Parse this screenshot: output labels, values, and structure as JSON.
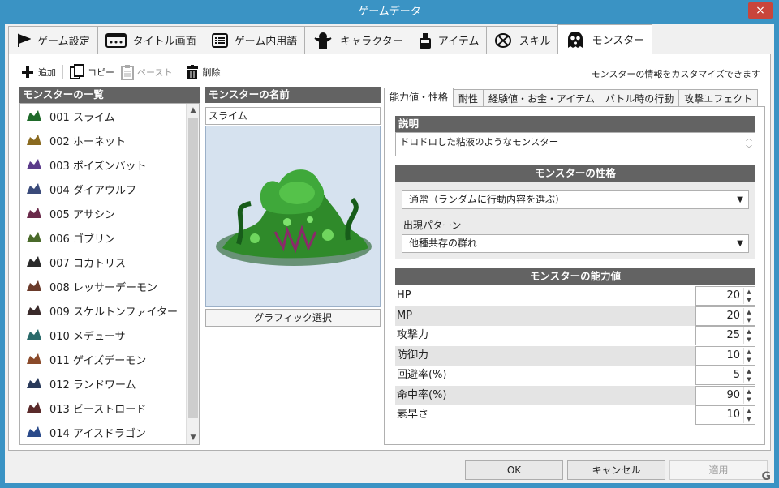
{
  "window": {
    "title": "ゲームデータ",
    "close": "×"
  },
  "tabs": [
    {
      "label": "ゲーム設定",
      "icon": "flag-icon"
    },
    {
      "label": "タイトル画面",
      "icon": "title-screen-icon"
    },
    {
      "label": "ゲーム内用語",
      "icon": "list-icon"
    },
    {
      "label": "キャラクター",
      "icon": "character-icon"
    },
    {
      "label": "アイテム",
      "icon": "potion-icon"
    },
    {
      "label": "スキル",
      "icon": "skill-icon"
    },
    {
      "label": "モンスター",
      "icon": "ghost-icon",
      "active": true
    }
  ],
  "toolbar": {
    "add": "追加",
    "copy": "コピー",
    "paste": "ペースト",
    "delete": "削除",
    "hint": "モンスターの情報をカスタマイズできます"
  },
  "list": {
    "header": "モンスターの一覧",
    "items": [
      "001 スライム",
      "002 ホーネット",
      "003 ポイズンバット",
      "004 ダイアウルフ",
      "005 アサシン",
      "006 ゴブリン",
      "007 コカトリス",
      "008 レッサーデーモン",
      "009 スケルトンファイター",
      "010 メデューサ",
      "011 ゲイズデーモン",
      "012 ランドワーム",
      "013 ビーストロード",
      "014 アイスドラゴン"
    ]
  },
  "name_panel": {
    "header": "モンスターの名前",
    "value": "スライム",
    "graphic_button": "グラフィック選択"
  },
  "detail_tabs": [
    "能力値・性格",
    "耐性",
    "経験値・お金・アイテム",
    "バトル時の行動",
    "攻撃エフェクト"
  ],
  "description": {
    "header": "説明",
    "text": "ドロドロした粘液のようなモンスター"
  },
  "personality": {
    "header": "モンスターの性格",
    "behavior": "通常（ランダムに行動内容を選ぶ）",
    "spawn_label": "出現パターン",
    "spawn": "他種共存の群れ"
  },
  "stats": {
    "header": "モンスターの能力値",
    "rows": [
      {
        "name": "HP",
        "value": "20"
      },
      {
        "name": "MP",
        "value": "20"
      },
      {
        "name": "攻撃力",
        "value": "25"
      },
      {
        "name": "防御力",
        "value": "10"
      },
      {
        "name": "回避率(%)",
        "value": "5"
      },
      {
        "name": "命中率(%)",
        "value": "90"
      },
      {
        "name": "素早さ",
        "value": "10"
      }
    ]
  },
  "buttons": {
    "ok": "OK",
    "cancel": "キャンセル",
    "apply": "適用"
  },
  "colors": {
    "titlebar": "#3a93c4",
    "section_header": "#636363",
    "slime": "#2f8a2a"
  }
}
